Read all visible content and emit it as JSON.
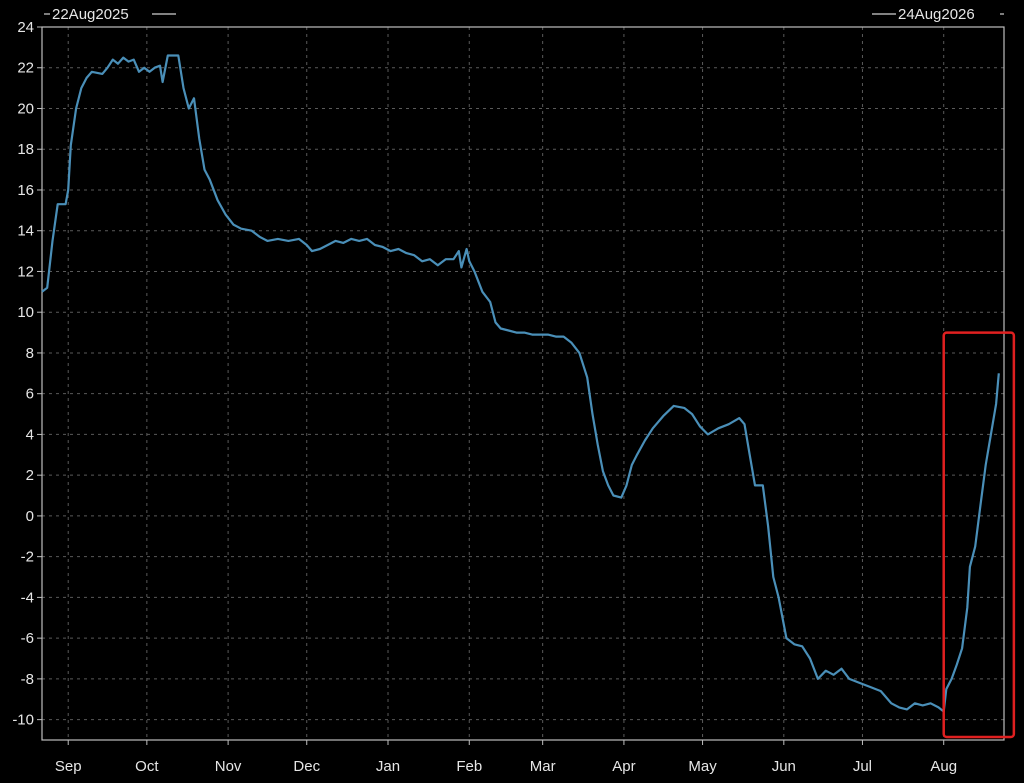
{
  "chart_data": {
    "type": "line",
    "start_label": "22Aug2025",
    "end_label": "24Aug2026",
    "x_range": [
      "2025-08-22",
      "2026-08-24"
    ],
    "ylim": [
      -11,
      24
    ],
    "y_ticks": [
      24,
      22,
      20,
      18,
      16,
      14,
      12,
      10,
      8,
      6,
      4,
      2,
      0,
      -2,
      -4,
      -6,
      -8,
      -10
    ],
    "x_ticks": [
      {
        "label": "Sep",
        "date": "2025-09-01"
      },
      {
        "label": "Oct",
        "date": "2025-10-01"
      },
      {
        "label": "Nov",
        "date": "2025-11-01"
      },
      {
        "label": "Dec",
        "date": "2025-12-01"
      },
      {
        "label": "Jan",
        "date": "2026-01-01"
      },
      {
        "label": "Feb",
        "date": "2026-02-01"
      },
      {
        "label": "Mar",
        "date": "2026-03-01"
      },
      {
        "label": "Apr",
        "date": "2026-04-01"
      },
      {
        "label": "May",
        "date": "2026-05-01"
      },
      {
        "label": "Jun",
        "date": "2026-06-01"
      },
      {
        "label": "Jul",
        "date": "2026-07-01"
      },
      {
        "label": "Aug",
        "date": "2026-08-01"
      }
    ],
    "grid": true,
    "line_color": "#4a8fb8",
    "highlight_color": "#e02020",
    "highlight_range": {
      "x": [
        "2026-08-01",
        "2026-08-27"
      ],
      "y": [
        -11,
        9
      ]
    },
    "series": [
      {
        "points": [
          [
            "2025-08-22",
            11.0
          ],
          [
            "2025-08-24",
            11.2
          ],
          [
            "2025-08-26",
            13.5
          ],
          [
            "2025-08-28",
            15.3
          ],
          [
            "2025-08-31",
            15.3
          ],
          [
            "2025-09-01",
            16.0
          ],
          [
            "2025-09-02",
            18.2
          ],
          [
            "2025-09-04",
            20.0
          ],
          [
            "2025-09-06",
            21.0
          ],
          [
            "2025-09-08",
            21.5
          ],
          [
            "2025-09-10",
            21.8
          ],
          [
            "2025-09-14",
            21.7
          ],
          [
            "2025-09-16",
            22.0
          ],
          [
            "2025-09-18",
            22.4
          ],
          [
            "2025-09-20",
            22.2
          ],
          [
            "2025-09-22",
            22.5
          ],
          [
            "2025-09-24",
            22.3
          ],
          [
            "2025-09-26",
            22.4
          ],
          [
            "2025-09-28",
            21.8
          ],
          [
            "2025-09-30",
            22.0
          ],
          [
            "2025-10-02",
            21.8
          ],
          [
            "2025-10-04",
            22.0
          ],
          [
            "2025-10-06",
            22.1
          ],
          [
            "2025-10-07",
            21.3
          ],
          [
            "2025-10-09",
            22.6
          ],
          [
            "2025-10-13",
            22.6
          ],
          [
            "2025-10-15",
            21.0
          ],
          [
            "2025-10-17",
            20.0
          ],
          [
            "2025-10-19",
            20.5
          ],
          [
            "2025-10-21",
            18.5
          ],
          [
            "2025-10-23",
            17.0
          ],
          [
            "2025-10-25",
            16.5
          ],
          [
            "2025-10-28",
            15.5
          ],
          [
            "2025-10-31",
            14.8
          ],
          [
            "2025-11-03",
            14.3
          ],
          [
            "2025-11-06",
            14.1
          ],
          [
            "2025-11-10",
            14.0
          ],
          [
            "2025-11-13",
            13.7
          ],
          [
            "2025-11-16",
            13.5
          ],
          [
            "2025-11-20",
            13.6
          ],
          [
            "2025-11-24",
            13.5
          ],
          [
            "2025-11-28",
            13.6
          ],
          [
            "2025-12-01",
            13.3
          ],
          [
            "2025-12-03",
            13.0
          ],
          [
            "2025-12-06",
            13.1
          ],
          [
            "2025-12-09",
            13.3
          ],
          [
            "2025-12-12",
            13.5
          ],
          [
            "2025-12-15",
            13.4
          ],
          [
            "2025-12-18",
            13.6
          ],
          [
            "2025-12-21",
            13.5
          ],
          [
            "2025-12-24",
            13.6
          ],
          [
            "2025-12-27",
            13.3
          ],
          [
            "2025-12-30",
            13.2
          ],
          [
            "2026-01-02",
            13.0
          ],
          [
            "2026-01-05",
            13.1
          ],
          [
            "2026-01-08",
            12.9
          ],
          [
            "2026-01-11",
            12.8
          ],
          [
            "2026-01-14",
            12.5
          ],
          [
            "2026-01-17",
            12.6
          ],
          [
            "2026-01-20",
            12.3
          ],
          [
            "2026-01-23",
            12.6
          ],
          [
            "2026-01-26",
            12.6
          ],
          [
            "2026-01-28",
            13.0
          ],
          [
            "2026-01-29",
            12.2
          ],
          [
            "2026-01-31",
            13.1
          ],
          [
            "2026-02-01",
            12.5
          ],
          [
            "2026-02-03",
            12.0
          ],
          [
            "2026-02-06",
            11.0
          ],
          [
            "2026-02-09",
            10.5
          ],
          [
            "2026-02-11",
            9.5
          ],
          [
            "2026-02-13",
            9.2
          ],
          [
            "2026-02-16",
            9.1
          ],
          [
            "2026-02-19",
            9.0
          ],
          [
            "2026-02-22",
            9.0
          ],
          [
            "2026-02-25",
            8.9
          ],
          [
            "2026-02-28",
            8.9
          ],
          [
            "2026-03-03",
            8.9
          ],
          [
            "2026-03-06",
            8.8
          ],
          [
            "2026-03-09",
            8.8
          ],
          [
            "2026-03-12",
            8.5
          ],
          [
            "2026-03-15",
            8.0
          ],
          [
            "2026-03-18",
            6.8
          ],
          [
            "2026-03-20",
            5.0
          ],
          [
            "2026-03-22",
            3.5
          ],
          [
            "2026-03-24",
            2.2
          ],
          [
            "2026-03-26",
            1.5
          ],
          [
            "2026-03-28",
            1.0
          ],
          [
            "2026-03-31",
            0.9
          ],
          [
            "2026-04-02",
            1.5
          ],
          [
            "2026-04-04",
            2.5
          ],
          [
            "2026-04-06",
            3.0
          ],
          [
            "2026-04-09",
            3.7
          ],
          [
            "2026-04-12",
            4.3
          ],
          [
            "2026-04-16",
            4.9
          ],
          [
            "2026-04-20",
            5.4
          ],
          [
            "2026-04-24",
            5.3
          ],
          [
            "2026-04-27",
            5.0
          ],
          [
            "2026-04-30",
            4.4
          ],
          [
            "2026-05-03",
            4.0
          ],
          [
            "2026-05-07",
            4.3
          ],
          [
            "2026-05-11",
            4.5
          ],
          [
            "2026-05-15",
            4.8
          ],
          [
            "2026-05-17",
            4.5
          ],
          [
            "2026-05-19",
            3.0
          ],
          [
            "2026-05-21",
            1.5
          ],
          [
            "2026-05-24",
            1.5
          ],
          [
            "2026-05-26",
            -0.5
          ],
          [
            "2026-05-28",
            -3.0
          ],
          [
            "2026-05-30",
            -4.0
          ],
          [
            "2026-06-02",
            -6.0
          ],
          [
            "2026-06-05",
            -6.3
          ],
          [
            "2026-06-08",
            -6.4
          ],
          [
            "2026-06-11",
            -7.0
          ],
          [
            "2026-06-14",
            -8.0
          ],
          [
            "2026-06-17",
            -7.6
          ],
          [
            "2026-06-20",
            -7.8
          ],
          [
            "2026-06-23",
            -7.5
          ],
          [
            "2026-06-26",
            -8.0
          ],
          [
            "2026-06-30",
            -8.2
          ],
          [
            "2026-07-04",
            -8.4
          ],
          [
            "2026-07-08",
            -8.6
          ],
          [
            "2026-07-12",
            -9.2
          ],
          [
            "2026-07-15",
            -9.4
          ],
          [
            "2026-07-18",
            -9.5
          ],
          [
            "2026-07-21",
            -9.2
          ],
          [
            "2026-07-24",
            -9.3
          ],
          [
            "2026-07-27",
            -9.2
          ],
          [
            "2026-07-30",
            -9.4
          ],
          [
            "2026-08-01",
            -9.6
          ],
          [
            "2026-08-02",
            -8.5
          ],
          [
            "2026-08-04",
            -8.0
          ],
          [
            "2026-08-06",
            -7.3
          ],
          [
            "2026-08-08",
            -6.5
          ],
          [
            "2026-08-10",
            -4.5
          ],
          [
            "2026-08-11",
            -2.5
          ],
          [
            "2026-08-13",
            -1.5
          ],
          [
            "2026-08-15",
            0.5
          ],
          [
            "2026-08-17",
            2.5
          ],
          [
            "2026-08-19",
            4.0
          ],
          [
            "2026-08-21",
            5.5
          ],
          [
            "2026-08-22",
            7.0
          ]
        ]
      }
    ]
  }
}
